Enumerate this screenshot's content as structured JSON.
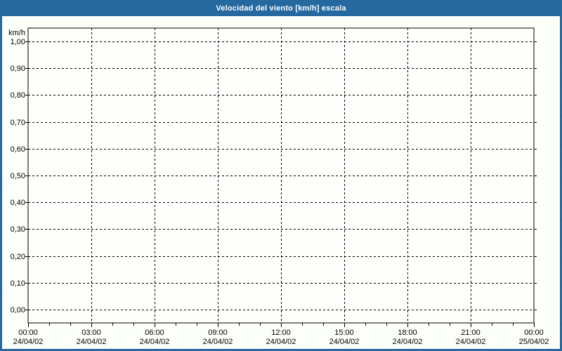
{
  "frame": {
    "title": "Velocidad del viento [km/h] escala",
    "colors": {
      "frame_blue": "#21669e",
      "title_text": "#ffffff",
      "content_bg": "#fcfff9",
      "plot_bg": "#fefffc",
      "grid_line": "#000000",
      "text": "#000000"
    }
  },
  "chart_data": {
    "type": "line",
    "title": "Velocidad del viento [km/h] escala",
    "ylabel": "km/h",
    "xlabel": "",
    "ylim": [
      0.0,
      1.0
    ],
    "y_tick_step": 0.1,
    "y_tick_labels": [
      "1,00",
      "0,90",
      "0,80",
      "0,70",
      "0,60",
      "0,50",
      "0,40",
      "0,30",
      "0,20",
      "0,10",
      "0,00"
    ],
    "x_tick_labels": [
      {
        "time": "00:00",
        "date": "24/04/02"
      },
      {
        "time": "03:00",
        "date": "24/04/02"
      },
      {
        "time": "06:00",
        "date": "24/04/02"
      },
      {
        "time": "09:00",
        "date": "24/04/02"
      },
      {
        "time": "12:00",
        "date": "24/04/02"
      },
      {
        "time": "15:00",
        "date": "24/04/02"
      },
      {
        "time": "18:00",
        "date": "24/04/02"
      },
      {
        "time": "21:00",
        "date": "24/04/02"
      },
      {
        "time": "00:00",
        "date": "25/04/02"
      }
    ],
    "x_minor_ticks_between_majors": 2,
    "grid": "dashed",
    "legend": "none",
    "series": []
  }
}
